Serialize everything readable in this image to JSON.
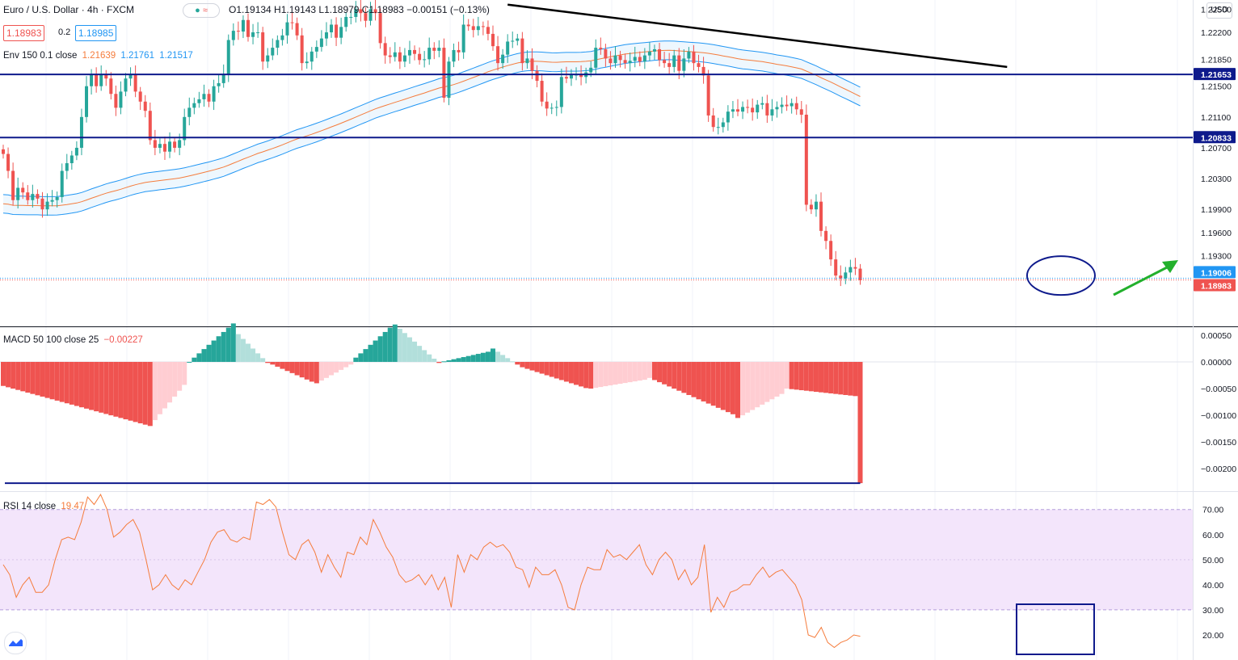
{
  "header": {
    "symbol": "Euro / U.S. Dollar · 4h · FXCM",
    "ohlc": "O1.19134 H1.19143 L1.18979 C1.18983 −0.00151 (−0.13%)",
    "bid": "1.18983",
    "spread": "0.2",
    "ask": "1.18985"
  },
  "indicators": {
    "env_label": "Env 150 0.1 close",
    "env_basis": "1.21639",
    "env_upper": "1.21761",
    "env_lower": "1.21517",
    "macd_label": "MACD 50 100 close 25",
    "macd_value": "−0.00227",
    "rsi_label": "RSI 14 close",
    "rsi_value": "19.47"
  },
  "currency_button": "USD",
  "colors": {
    "up": "#26a69a",
    "down": "#ef5350",
    "env_basis": "#f57c3c",
    "env_band": "#2196f3",
    "level": "#0e1a8c",
    "hist_up_strong": "#26a69a",
    "hist_up_weak": "#b2dfdb",
    "hist_down_strong": "#ef5350",
    "hist_down_weak": "#ffcdd2",
    "rsi_line": "#f57c3c",
    "rsi_band": "#f3e5fb",
    "arrow": "#22b02c"
  },
  "price_axis": {
    "range": [
      1.1838,
      1.2262
    ],
    "ticks": [
      "1.22500",
      "1.22200",
      "1.21850",
      "1.21500",
      "1.21100",
      "1.20700",
      "1.20300",
      "1.19900",
      "1.19600",
      "1.19300"
    ],
    "levels": [
      {
        "value": "1.21653",
        "num": 1.21653
      },
      {
        "value": "1.20833",
        "num": 1.20833
      }
    ],
    "current": [
      {
        "value": "1.19006",
        "num": 1.19006,
        "color": "#2196f3"
      },
      {
        "value": "1.18983",
        "num": 1.18983,
        "color": "#ef5350"
      }
    ]
  },
  "macd_axis": {
    "range": [
      -0.00242,
      0.00065
    ],
    "ticks": [
      "0.00050",
      "0.00000",
      "−0.00050",
      "−0.00100",
      "−0.00150",
      "−0.00200"
    ]
  },
  "rsi_axis": {
    "range": [
      10,
      77
    ],
    "ticks": [
      "70.00",
      "60.00",
      "50.00",
      "40.00",
      "30.00",
      "20.00"
    ],
    "band": [
      30,
      70
    ]
  },
  "chart_data": [
    {
      "type": "candlestick",
      "title": "Euro / U.S. Dollar · 4h · FXCM",
      "timeframe": "4h",
      "open_approx": [
        1.2068,
        1.2062,
        1.204,
        1.2002,
        1.2018,
        1.2012,
        1.2002,
        1.201,
        1.2004,
        1.199,
        1.2,
        1.2002,
        1.2006,
        1.204,
        1.205,
        1.206,
        1.207,
        1.211,
        1.215,
        1.2165,
        1.215,
        1.2165,
        1.216,
        1.214,
        1.2122,
        1.2143,
        1.216,
        1.2165,
        1.2143,
        1.213,
        1.2118,
        1.208,
        1.207,
        1.2075,
        1.2065,
        1.2078,
        1.207,
        1.208,
        1.211,
        1.2122,
        1.2128,
        1.2133,
        1.214,
        1.213,
        1.215,
        1.2154,
        1.2165,
        1.221,
        1.2222,
        1.2221,
        1.2236,
        1.2214,
        1.222,
        1.222,
        1.2182,
        1.219,
        1.22,
        1.221,
        1.2216,
        1.2233,
        1.2232,
        1.2216,
        1.218,
        1.2182,
        1.2195,
        1.2201,
        1.2212,
        1.222,
        1.223,
        1.2213,
        1.2227,
        1.224,
        1.224,
        1.225,
        1.2245,
        1.2235,
        1.225,
        1.2245,
        1.2206,
        1.219,
        1.2188,
        1.2194,
        1.2182,
        1.219,
        1.2197,
        1.2192,
        1.2184,
        1.2185,
        1.22,
        1.2196,
        1.22,
        1.2135,
        1.2182,
        1.2197,
        1.2194,
        1.223,
        1.2228,
        1.2223,
        1.2228,
        1.2227,
        1.2218,
        1.2202,
        1.218,
        1.2191,
        1.2208,
        1.2209,
        1.2212,
        1.218,
        1.2186,
        1.217,
        1.2157,
        1.213,
        1.2121,
        1.2122,
        1.2123,
        1.2162,
        1.216,
        1.2165,
        1.2165,
        1.2162,
        1.2168,
        1.2174,
        1.22,
        1.2198,
        1.2186,
        1.218,
        1.219,
        1.2184,
        1.218,
        1.2183,
        1.2188,
        1.2182,
        1.219,
        1.2195,
        1.2198,
        1.2184,
        1.218,
        1.2175,
        1.219,
        1.217,
        1.2186,
        1.2195,
        1.218,
        1.2175,
        1.2164,
        1.2112,
        1.2097,
        1.2097,
        1.2103,
        1.2117,
        1.212,
        1.2117,
        1.2123,
        1.2122,
        1.2116,
        1.2126,
        1.2128,
        1.2112,
        1.212,
        1.2123,
        1.2126,
        1.2124,
        1.2128,
        1.212,
        1.2113,
        1.1996,
        1.199,
        1.2,
        1.1962,
        1.1949,
        1.1925,
        1.1904,
        1.19,
        1.1908,
        1.1915,
        1.1913
      ],
      "close_approx": [
        1.2062,
        1.204,
        1.2002,
        1.2018,
        1.2012,
        1.2002,
        1.201,
        1.2004,
        1.199,
        1.2,
        1.2002,
        1.2006,
        1.204,
        1.205,
        1.206,
        1.207,
        1.211,
        1.215,
        1.2165,
        1.215,
        1.2165,
        1.216,
        1.214,
        1.2122,
        1.2143,
        1.216,
        1.2165,
        1.2143,
        1.213,
        1.2118,
        1.208,
        1.207,
        1.2075,
        1.2065,
        1.2078,
        1.207,
        1.208,
        1.211,
        1.2122,
        1.2128,
        1.2133,
        1.214,
        1.213,
        1.215,
        1.2154,
        1.2165,
        1.221,
        1.2222,
        1.2221,
        1.2236,
        1.2214,
        1.222,
        1.222,
        1.2182,
        1.219,
        1.22,
        1.221,
        1.2216,
        1.2233,
        1.2232,
        1.2216,
        1.218,
        1.2182,
        1.2195,
        1.2201,
        1.2212,
        1.222,
        1.223,
        1.2213,
        1.2227,
        1.224,
        1.224,
        1.225,
        1.2245,
        1.2235,
        1.225,
        1.2245,
        1.2206,
        1.219,
        1.2188,
        1.2194,
        1.2182,
        1.219,
        1.2197,
        1.2192,
        1.2184,
        1.2185,
        1.22,
        1.2196,
        1.22,
        1.2135,
        1.2182,
        1.2197,
        1.2194,
        1.223,
        1.2228,
        1.2223,
        1.2228,
        1.2227,
        1.2218,
        1.2202,
        1.218,
        1.2191,
        1.2208,
        1.2209,
        1.2212,
        1.218,
        1.2186,
        1.217,
        1.2157,
        1.213,
        1.2121,
        1.2122,
        1.2123,
        1.2162,
        1.216,
        1.2165,
        1.2165,
        1.2162,
        1.2168,
        1.2174,
        1.22,
        1.2198,
        1.2186,
        1.218,
        1.219,
        1.2184,
        1.218,
        1.2183,
        1.2188,
        1.2182,
        1.219,
        1.2195,
        1.2198,
        1.2184,
        1.218,
        1.2175,
        1.219,
        1.217,
        1.2186,
        1.2195,
        1.218,
        1.2175,
        1.2164,
        1.2112,
        1.2097,
        1.2097,
        1.2103,
        1.2117,
        1.212,
        1.2117,
        1.2123,
        1.2122,
        1.2116,
        1.2126,
        1.2128,
        1.2112,
        1.212,
        1.2123,
        1.2126,
        1.2124,
        1.2128,
        1.212,
        1.2113,
        1.1996,
        1.199,
        1.2,
        1.1962,
        1.1949,
        1.1925,
        1.1904,
        1.19,
        1.1908,
        1.1915,
        1.1913,
        1.1898
      ]
    },
    {
      "type": "line",
      "title": "MACD 50 100 close 25",
      "series": [
        {
          "name": "histogram",
          "last": -0.00227
        }
      ],
      "ylim": [
        -0.00242,
        0.00065
      ]
    },
    {
      "type": "line",
      "title": "RSI 14 close",
      "series": [
        {
          "name": "RSI",
          "values": [
            48,
            44,
            35,
            40,
            43,
            37,
            37,
            40,
            50,
            58,
            59,
            58,
            65,
            75,
            72,
            76,
            70,
            59,
            61,
            64,
            66,
            61,
            50,
            38,
            40,
            44,
            40,
            38,
            42,
            40,
            45,
            50,
            57,
            61,
            62,
            58,
            57,
            59,
            58,
            73,
            72,
            74,
            71,
            61,
            52,
            50,
            56,
            58,
            53,
            45,
            52,
            47,
            43,
            53,
            52,
            59,
            56,
            66,
            61,
            55,
            51,
            44,
            41,
            42,
            44,
            40,
            44,
            38,
            43,
            31,
            52,
            45,
            52,
            50,
            55,
            57,
            55,
            56,
            53,
            47,
            46,
            39,
            47,
            44,
            44,
            46,
            40,
            31,
            30,
            40,
            47,
            46,
            46,
            54,
            51,
            52,
            50,
            53,
            56,
            48,
            44,
            50,
            53,
            50,
            42,
            46,
            40,
            43,
            56,
            29,
            35,
            31,
            37,
            38,
            40,
            40,
            44,
            47,
            43,
            45,
            46,
            43,
            40,
            34,
            20,
            19,
            23,
            17,
            15,
            17,
            18,
            20,
            19.47
          ]
        }
      ],
      "ylim": [
        10,
        77
      ]
    }
  ]
}
